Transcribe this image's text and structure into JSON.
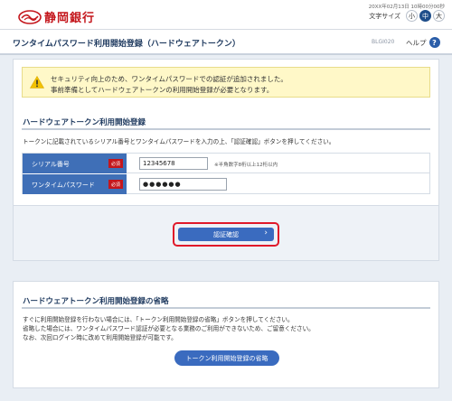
{
  "header": {
    "bank_name": "静岡銀行",
    "datetime": "20XX年02月13日 10時00分00秒",
    "font_size_label": "文字サイズ",
    "font_sizes": [
      "小",
      "中",
      "大"
    ],
    "font_size_selected": "中"
  },
  "page": {
    "title": "ワンタイムパスワード利用開始登録（ハードウェアトークン）",
    "screen_id": "BLGI020",
    "help_label": "ヘルプ",
    "help_icon": "?"
  },
  "warning": {
    "icon": "warning-icon",
    "line1": "セキュリティ向上のため、ワンタイムパスワードでの認証が追加されました。",
    "line2": "事前準備としてハードウェアトークンの利用開始登録が必要となります。"
  },
  "registration": {
    "title": "ハードウェアトークン利用開始登録",
    "description": "トークンに記載されているシリアル番号とワンタイムパスワードを入力の上、「認証確認」ボタンを押してください。",
    "fields": [
      {
        "label": "シリアル番号",
        "required": "必須",
        "value": "12345678",
        "hint": "※半角数字8桁以上12桁以内"
      },
      {
        "label": "ワンタイムパスワード",
        "required": "必須",
        "value": "●●●●●●"
      }
    ],
    "submit_label": "認証確認",
    "submit_chevron": "›"
  },
  "skip": {
    "title": "ハードウェアトークン利用開始登録の省略",
    "line1": "すぐに利用開始登録を行わない場合には、「トークン利用開始登録の省略」ボタンを押してください。",
    "line2": "省略した場合には、ワンタイムパスワード認証が必要となる業務のご利用ができないため、ご留意ください。",
    "line3": "なお、次回ログイン時に改めて利用開始登録が可能です。",
    "button_label": "トークン利用開始登録の省略"
  },
  "colors": {
    "brand_red": "#c4161c",
    "primary_blue": "#3a6bbf",
    "label_blue": "#3f6fb7",
    "warning_bg": "#fff8c8"
  }
}
